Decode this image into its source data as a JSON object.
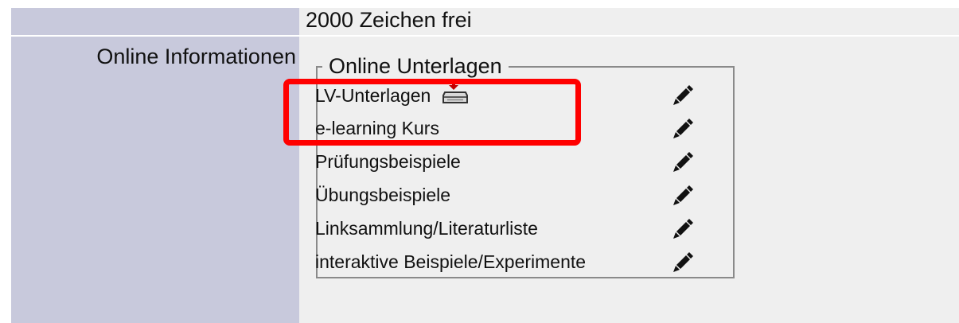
{
  "chars_free": "2000 Zeichen frei",
  "online_info_label": "Online Informationen",
  "fieldset_legend": "Online Unterlagen",
  "items": [
    {
      "label": "LV-Unterlagen",
      "has_download": true
    },
    {
      "label": "e-learning Kurs"
    },
    {
      "label": "Prüfungsbeispiele"
    },
    {
      "label": "Übungsbeispiele"
    },
    {
      "label": "Linksammlung/Literaturliste"
    },
    {
      "label": "interaktive Beispiele/Experimente"
    }
  ],
  "icons": {
    "edit": "pencil-icon",
    "download": "download-icon"
  },
  "colors": {
    "label_bg": "#c8c9dc",
    "value_bg": "#efefef",
    "highlight": "#ff0000"
  }
}
